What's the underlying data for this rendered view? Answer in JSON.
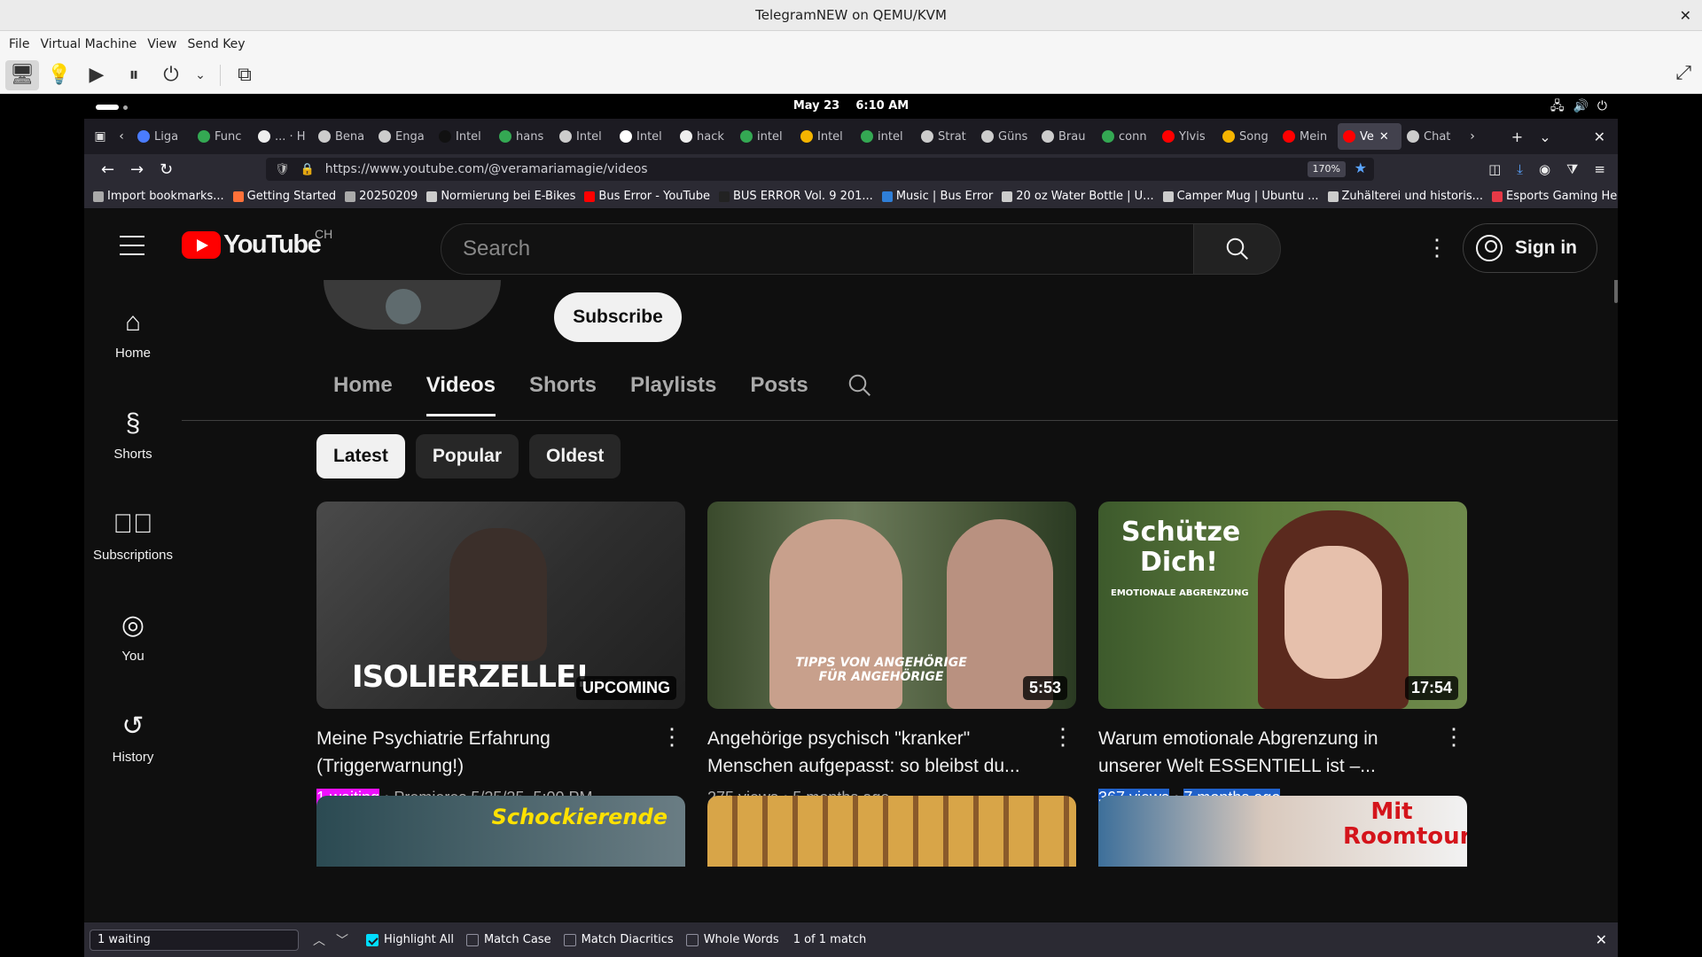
{
  "host": {
    "title": "TelegramNEW on QEMU/KVM",
    "menu": [
      "File",
      "Virtual Machine",
      "View",
      "Send Key"
    ]
  },
  "gnome": {
    "date": "May 23",
    "time": "6:10 AM"
  },
  "browser": {
    "tabs": [
      {
        "label": "Liga",
        "color": "#4a7cff"
      },
      {
        "label": "Func",
        "color": "#34a853"
      },
      {
        "label": "... · H",
        "color": "#eeeeee"
      },
      {
        "label": "Bena",
        "color": "#cccccc"
      },
      {
        "label": "Enga",
        "color": "#cccccc"
      },
      {
        "label": "Intel",
        "color": "#111111"
      },
      {
        "label": "hans",
        "color": "#34a853"
      },
      {
        "label": "Intel",
        "color": "#cccccc"
      },
      {
        "label": "Intel",
        "color": "#ffffff"
      },
      {
        "label": "hack",
        "color": "#eeeeee"
      },
      {
        "label": "intel",
        "color": "#34a853"
      },
      {
        "label": "Intel",
        "color": "#f4b400"
      },
      {
        "label": "intel",
        "color": "#34a853"
      },
      {
        "label": "Strat",
        "color": "#cccccc"
      },
      {
        "label": "Güns",
        "color": "#cccccc"
      },
      {
        "label": "Brau",
        "color": "#cccccc"
      },
      {
        "label": "conn",
        "color": "#34a853"
      },
      {
        "label": "Ylvis",
        "color": "#ff0000"
      },
      {
        "label": "Song",
        "color": "#f4b400"
      },
      {
        "label": "Mein",
        "color": "#ff0000"
      },
      {
        "label": "Ve",
        "color": "#ff0000",
        "selected": true
      },
      {
        "label": "Chat",
        "color": "#cccccc"
      }
    ],
    "url": "https://www.youtube.com/@veramariamagie/videos",
    "zoom": "170%",
    "bookmarks": [
      {
        "label": "Import bookmarks...",
        "color": "#aaaaaa"
      },
      {
        "label": "Getting Started",
        "color": "#ff7139"
      },
      {
        "label": "20250209",
        "color": "#aaaaaa"
      },
      {
        "label": "Normierung bei E-Bikes",
        "color": "#cccccc"
      },
      {
        "label": "Bus Error - YouTube",
        "color": "#ff0000"
      },
      {
        "label": "BUS ERROR Vol. 9 201...",
        "color": "#222222"
      },
      {
        "label": "Music | Bus Error",
        "color": "#2f7fd8"
      },
      {
        "label": "20 oz Water Bottle | U...",
        "color": "#cccccc"
      },
      {
        "label": "Camper Mug | Ubuntu ...",
        "color": "#cccccc"
      },
      {
        "label": "Zuhälterei und historis...",
        "color": "#cccccc"
      },
      {
        "label": "Esports Gaming Head...",
        "color": "#e63946"
      }
    ]
  },
  "youtube": {
    "country": "CH",
    "search_placeholder": "Search",
    "signin": "Sign in",
    "wordmark": "YouTube",
    "guide": [
      "Home",
      "Shorts",
      "Subscriptions",
      "You",
      "History"
    ],
    "subscribe": "Subscribe",
    "channel_tabs": [
      "Home",
      "Videos",
      "Shorts",
      "Playlists",
      "Posts"
    ],
    "active_tab": "Videos",
    "chips": [
      "Latest",
      "Popular",
      "Oldest"
    ],
    "active_chip": "Latest",
    "videos": [
      {
        "title": "Meine Psychiatrie Erfahrung (Triggerwarnung!)",
        "thumb_text": "ISOLIERZELLE!",
        "badge": "UPCOMING",
        "meta_a": "1 waiting",
        "meta_b": "Premieres 5/25/25, 5:00 PM"
      },
      {
        "title": "Angehörige psychisch \"kranker\" Menschen aufgepasst: so bleibst du...",
        "thumb_text": "TIPPS VON ANGEHÖRIGE FÜR ANGEHÖRIGE",
        "badge": "5:53",
        "meta_a": "275 views",
        "meta_b": "5 months ago"
      },
      {
        "title": "Warum emotionale Abgrenzung in unserer Welt ESSENTIELL ist –...",
        "thumb_text": "Schütze Dich!",
        "thumb_sub": "EMOTIONALE ABGRENZUNG",
        "badge": "17:54",
        "meta_a": "367 views",
        "meta_b": "7 months ago"
      }
    ],
    "row2_texts": [
      "Schockierende",
      "",
      "Mit Roomtour"
    ]
  },
  "findbar": {
    "query": "1 waiting",
    "highlight_all": "Highlight All",
    "match_case": "Match Case",
    "match_diacritics": "Match Diacritics",
    "whole_words": "Whole Words",
    "status": "1 of 1 match"
  }
}
